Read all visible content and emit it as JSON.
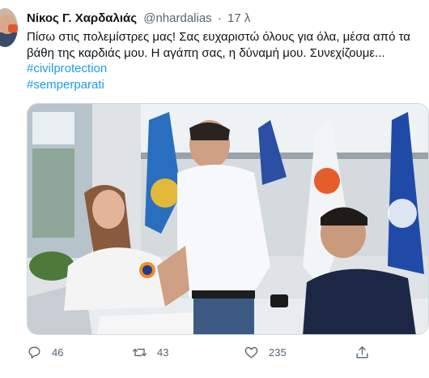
{
  "tweet": {
    "author_name": "Νίκος Γ. Χαρδαλιάς",
    "handle": "@nhardalias",
    "separator": "·",
    "time": "17 λ",
    "text": "Πίσω στις πολεμίστρες μας! Σας ευχαριστώ όλους για όλα, μέσα από τα βάθη της καρδιάς μου. Η αγάπη σας, η δύναμή μου. Συνεχίζουμε...",
    "hashtags": [
      "#civilprotection",
      "#semperparati"
    ]
  },
  "actions": {
    "replies": "46",
    "retweets": "43",
    "likes": "235"
  },
  "icons": [
    "avatar",
    "reply-icon",
    "retweet-icon",
    "like-icon",
    "share-icon"
  ],
  "colors": {
    "link": "#1d9bf0",
    "muted": "#536471",
    "text": "#0f1419"
  }
}
